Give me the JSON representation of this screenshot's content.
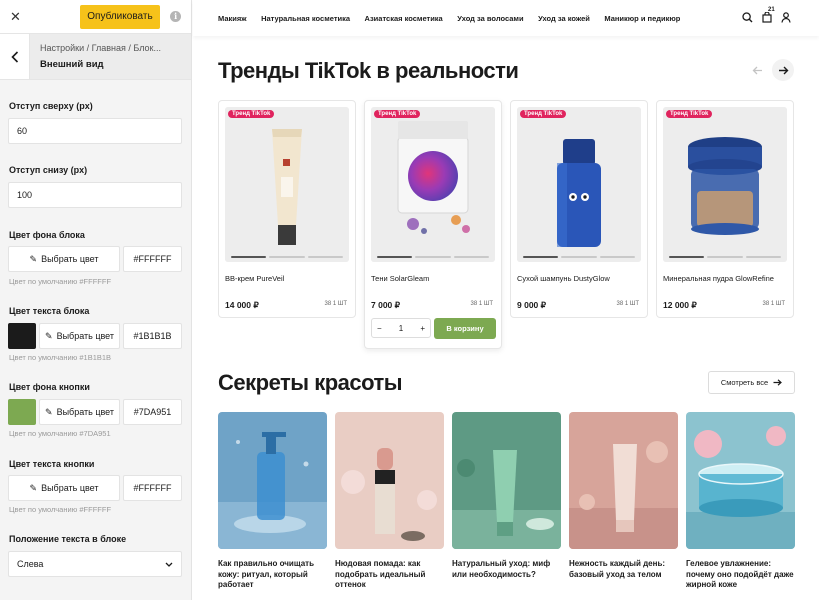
{
  "editor": {
    "publish_label": "Опубликовать",
    "breadcrumb": "Настройки / Главная / Блок...",
    "section_title": "Внешний вид",
    "padding_top_label": "Отступ сверху (px)",
    "padding_top_value": "60",
    "padding_bottom_label": "Отступ снизу (px)",
    "padding_bottom_value": "100",
    "pick_color_label": "Выбрать цвет",
    "colors": [
      {
        "label": "Цвет фона блока",
        "value": "#FFFFFF",
        "hint": "Цвет по умолчанию #FFFFFF",
        "swatch": ""
      },
      {
        "label": "Цвет текста блока",
        "value": "#1B1B1B",
        "hint": "Цвет по умолчанию #1B1B1B",
        "swatch": "#1b1b1b"
      },
      {
        "label": "Цвет фона кнопки",
        "value": "#7DA951",
        "hint": "Цвет по умолчанию #7DA951",
        "swatch": "#7da951"
      },
      {
        "label": "Цвет текста кнопки",
        "value": "#FFFFFF",
        "hint": "Цвет по умолчанию #FFFFFF",
        "swatch": ""
      }
    ],
    "text_position_label": "Положение текста в блоке",
    "text_position_value": "Слева",
    "accent_color": "#f6c21a"
  },
  "site": {
    "nav": [
      "Макияж",
      "Натуральная косметика",
      "Азиатская косметика",
      "Уход за волосами",
      "Уход за кожей",
      "Маникюр и педикюр"
    ],
    "cart_count": "21",
    "section1_title": "Тренды TikTok в реальности",
    "badge": "Тренд TikTok",
    "products": [
      {
        "name": "BB-крем PureVeil",
        "price": "14 000 ₽",
        "qty": "38 1 ШТ"
      },
      {
        "name": "Тени SolarGleam",
        "price": "7 000 ₽",
        "qty": "38 1 ШТ"
      },
      {
        "name": "Сухой шампунь DustyGlow",
        "price": "9 000 ₽",
        "qty": "38 1 ШТ"
      },
      {
        "name": "Минеральная пудра GlowRefine",
        "price": "12 000 ₽",
        "qty": "38 1 ШТ"
      }
    ],
    "stepper_value": "1",
    "add_to_cart": "В корзину",
    "section2_title": "Секреты красоты",
    "see_all": "Смотреть все",
    "articles": [
      {
        "title": "Как правильно очищать кожу: ритуал, который работает"
      },
      {
        "title": "Нюдовая помада: как подобрать идеальный оттенок"
      },
      {
        "title": "Натуральный уход: миф или необходимость?"
      },
      {
        "title": "Нежность каждый день: базовый уход за телом"
      },
      {
        "title": "Гелевое увлажнение: почему оно подойдёт даже жирной коже"
      }
    ],
    "button_color": "#7da951",
    "badge_color": "#e0245e"
  }
}
